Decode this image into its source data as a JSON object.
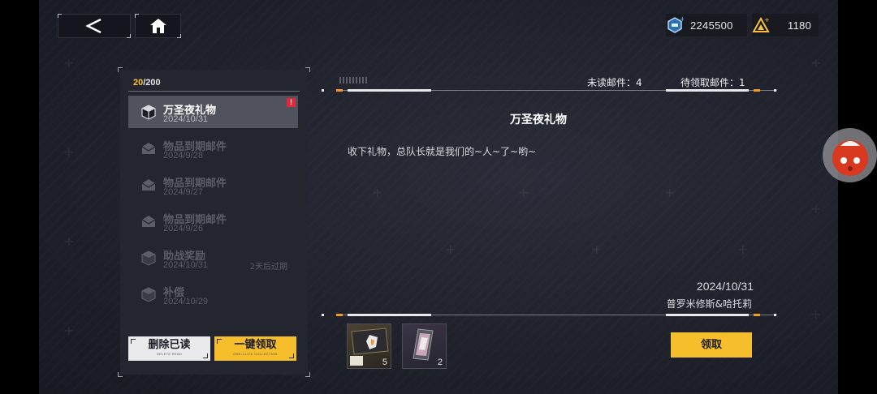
{
  "topbar": {
    "back_icon": "chevron-left-icon",
    "home_icon": "home-icon",
    "currency_primary": "2245500",
    "currency_secondary": "1180"
  },
  "mailbox": {
    "count_current": "20",
    "count_total": "/200",
    "items": [
      {
        "title": "万圣夜礼物",
        "date": "2024/10/31",
        "expire": "",
        "icon": "gift-box-icon",
        "state": "selected",
        "unread_badge": "!"
      },
      {
        "title": "物品到期邮件",
        "date": "2024/9/28",
        "expire": "",
        "icon": "envelope-icon",
        "state": "read"
      },
      {
        "title": "物品到期邮件",
        "date": "2024/9/27",
        "expire": "",
        "icon": "envelope-icon",
        "state": "read"
      },
      {
        "title": "物品到期邮件",
        "date": "2024/9/26",
        "expire": "",
        "icon": "envelope-icon",
        "state": "read"
      },
      {
        "title": "助战奖励",
        "date": "2024/10/31",
        "expire": "2天后过期",
        "icon": "gift-box-icon",
        "state": "read"
      },
      {
        "title": "补偿",
        "date": "2024/10/29",
        "expire": "",
        "icon": "gift-box-icon",
        "state": "read"
      }
    ],
    "delete_read_label": "删除已读",
    "delete_read_sub": "DELETE READ",
    "collect_all_label": "一键领取",
    "collect_all_sub": "ONE-CLICK COLLECTION"
  },
  "detail": {
    "unread_label": "未读邮件：4",
    "pending_label": "待领取邮件：1",
    "title": "万圣夜礼物",
    "body": "收下礼物，总队长就是我们的~人~了~哟~",
    "date": "2024/10/31",
    "sender": "普罗米修斯&哈托莉",
    "rewards": [
      {
        "icon": "data-card-icon",
        "quantity": "5"
      },
      {
        "icon": "phone-device-icon",
        "quantity": "2"
      }
    ],
    "claim_label": "领取"
  },
  "colors": {
    "accent": "#f7be2c",
    "badge": "#e8263a",
    "background": "#1f212b"
  }
}
